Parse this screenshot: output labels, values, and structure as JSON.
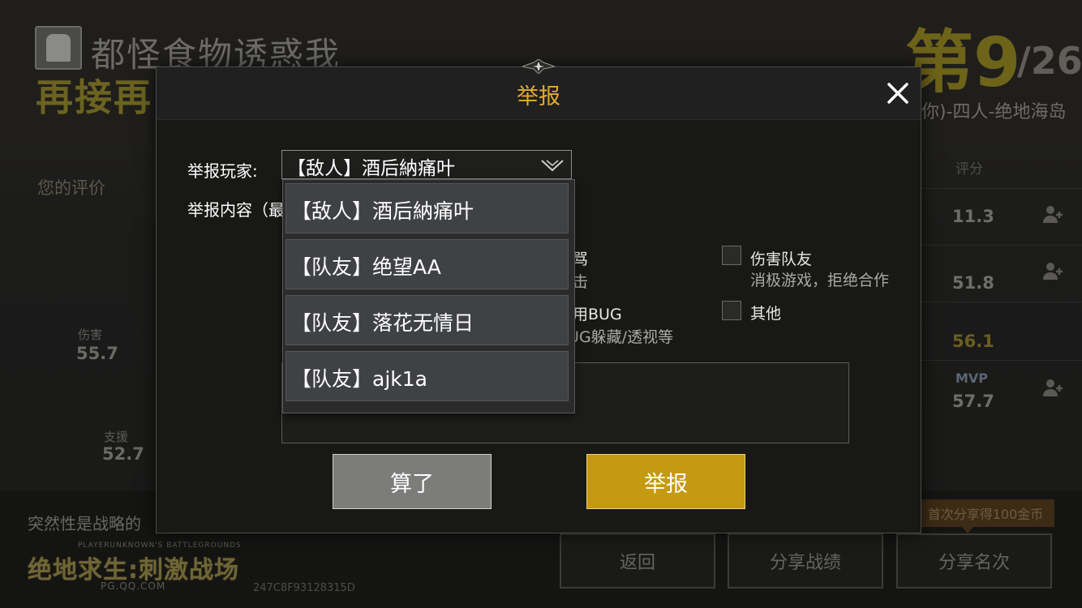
{
  "background": {
    "player_title": "都怪食物诱惑我",
    "slogan": "再接再",
    "rank_prefix": "第9",
    "rank_total": "/26",
    "mode": "你)-四人-绝地海岛",
    "eval_label": "您的评价",
    "stats": {
      "damage_label": "伤害",
      "damage_value": "55.7",
      "support_label": "支援",
      "support_value": "52.7"
    },
    "score_header": "评分",
    "scores": [
      "11.3",
      "51.8",
      "56.1",
      "57.7"
    ],
    "mvp_badge": "MVP",
    "tip_text": "突然性是战略的",
    "logo_small": "PLAYERUNKNOWN'S BATTLEGROUNDS",
    "logo": "绝地求生:刺激战场",
    "logo_url": "PG.QQ.COM",
    "match_id": "247C8F93128315D",
    "buttons": {
      "back": "返回",
      "share_record": "分享战绩",
      "share_rank": "分享名次"
    },
    "share_tip": "首次分享得100金币"
  },
  "modal": {
    "title": "举报",
    "close_icon": "close-icon",
    "player_label": "举报玩家:",
    "content_label": "举报内容（最",
    "selected_player": "【敌人】酒后納痛叶",
    "reasons": {
      "abuse_title": "言语辱骂",
      "abuse_desc": "言语攻击",
      "harm_title": "伤害队友",
      "harm_desc": "消极游戏，拒绝合作",
      "bug_title": "恶意使用BUG",
      "bug_desc": "利用BUG躲藏/透视等",
      "other_title": "其他"
    },
    "cancel_label": "算了",
    "report_label": "举报"
  },
  "dropdown": {
    "options": [
      "【敌人】酒后納痛叶",
      "【队友】绝望AA",
      "【队友】落花无情日",
      "【队友】ajk1a"
    ]
  },
  "colors": {
    "accent_gold": "#c49a12",
    "title_gold": "#e1ad2a",
    "cancel_gray": "#7c7c7b"
  }
}
